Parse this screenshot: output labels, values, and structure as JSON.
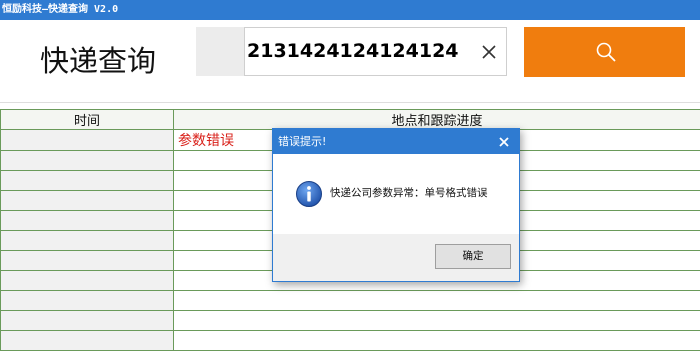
{
  "window": {
    "title": "恒励科技—快递查询 V2.0"
  },
  "header": {
    "heading": "快递查询",
    "search": {
      "value": "2131424124124124",
      "placeholder": ""
    },
    "clear_icon": "close-icon",
    "search_icon": "search-icon",
    "search_button_color": "#f07d0e"
  },
  "table": {
    "columns": [
      "时间",
      "地点和跟踪进度"
    ],
    "rows": [
      [
        "",
        "参数错误"
      ],
      [
        "",
        ""
      ],
      [
        "",
        ""
      ],
      [
        "",
        ""
      ],
      [
        "",
        ""
      ],
      [
        "",
        ""
      ],
      [
        "",
        ""
      ],
      [
        "",
        ""
      ],
      [
        "",
        ""
      ],
      [
        "",
        ""
      ],
      [
        "",
        ""
      ]
    ],
    "error_color": "#d9201a",
    "grid_color": "#6a9a5a"
  },
  "dialog": {
    "title": "错误提示!",
    "message": "快递公司参数异常：单号格式错误",
    "ok_label": "确定",
    "icon": "info-icon",
    "title_color": "#2f7bd1"
  }
}
